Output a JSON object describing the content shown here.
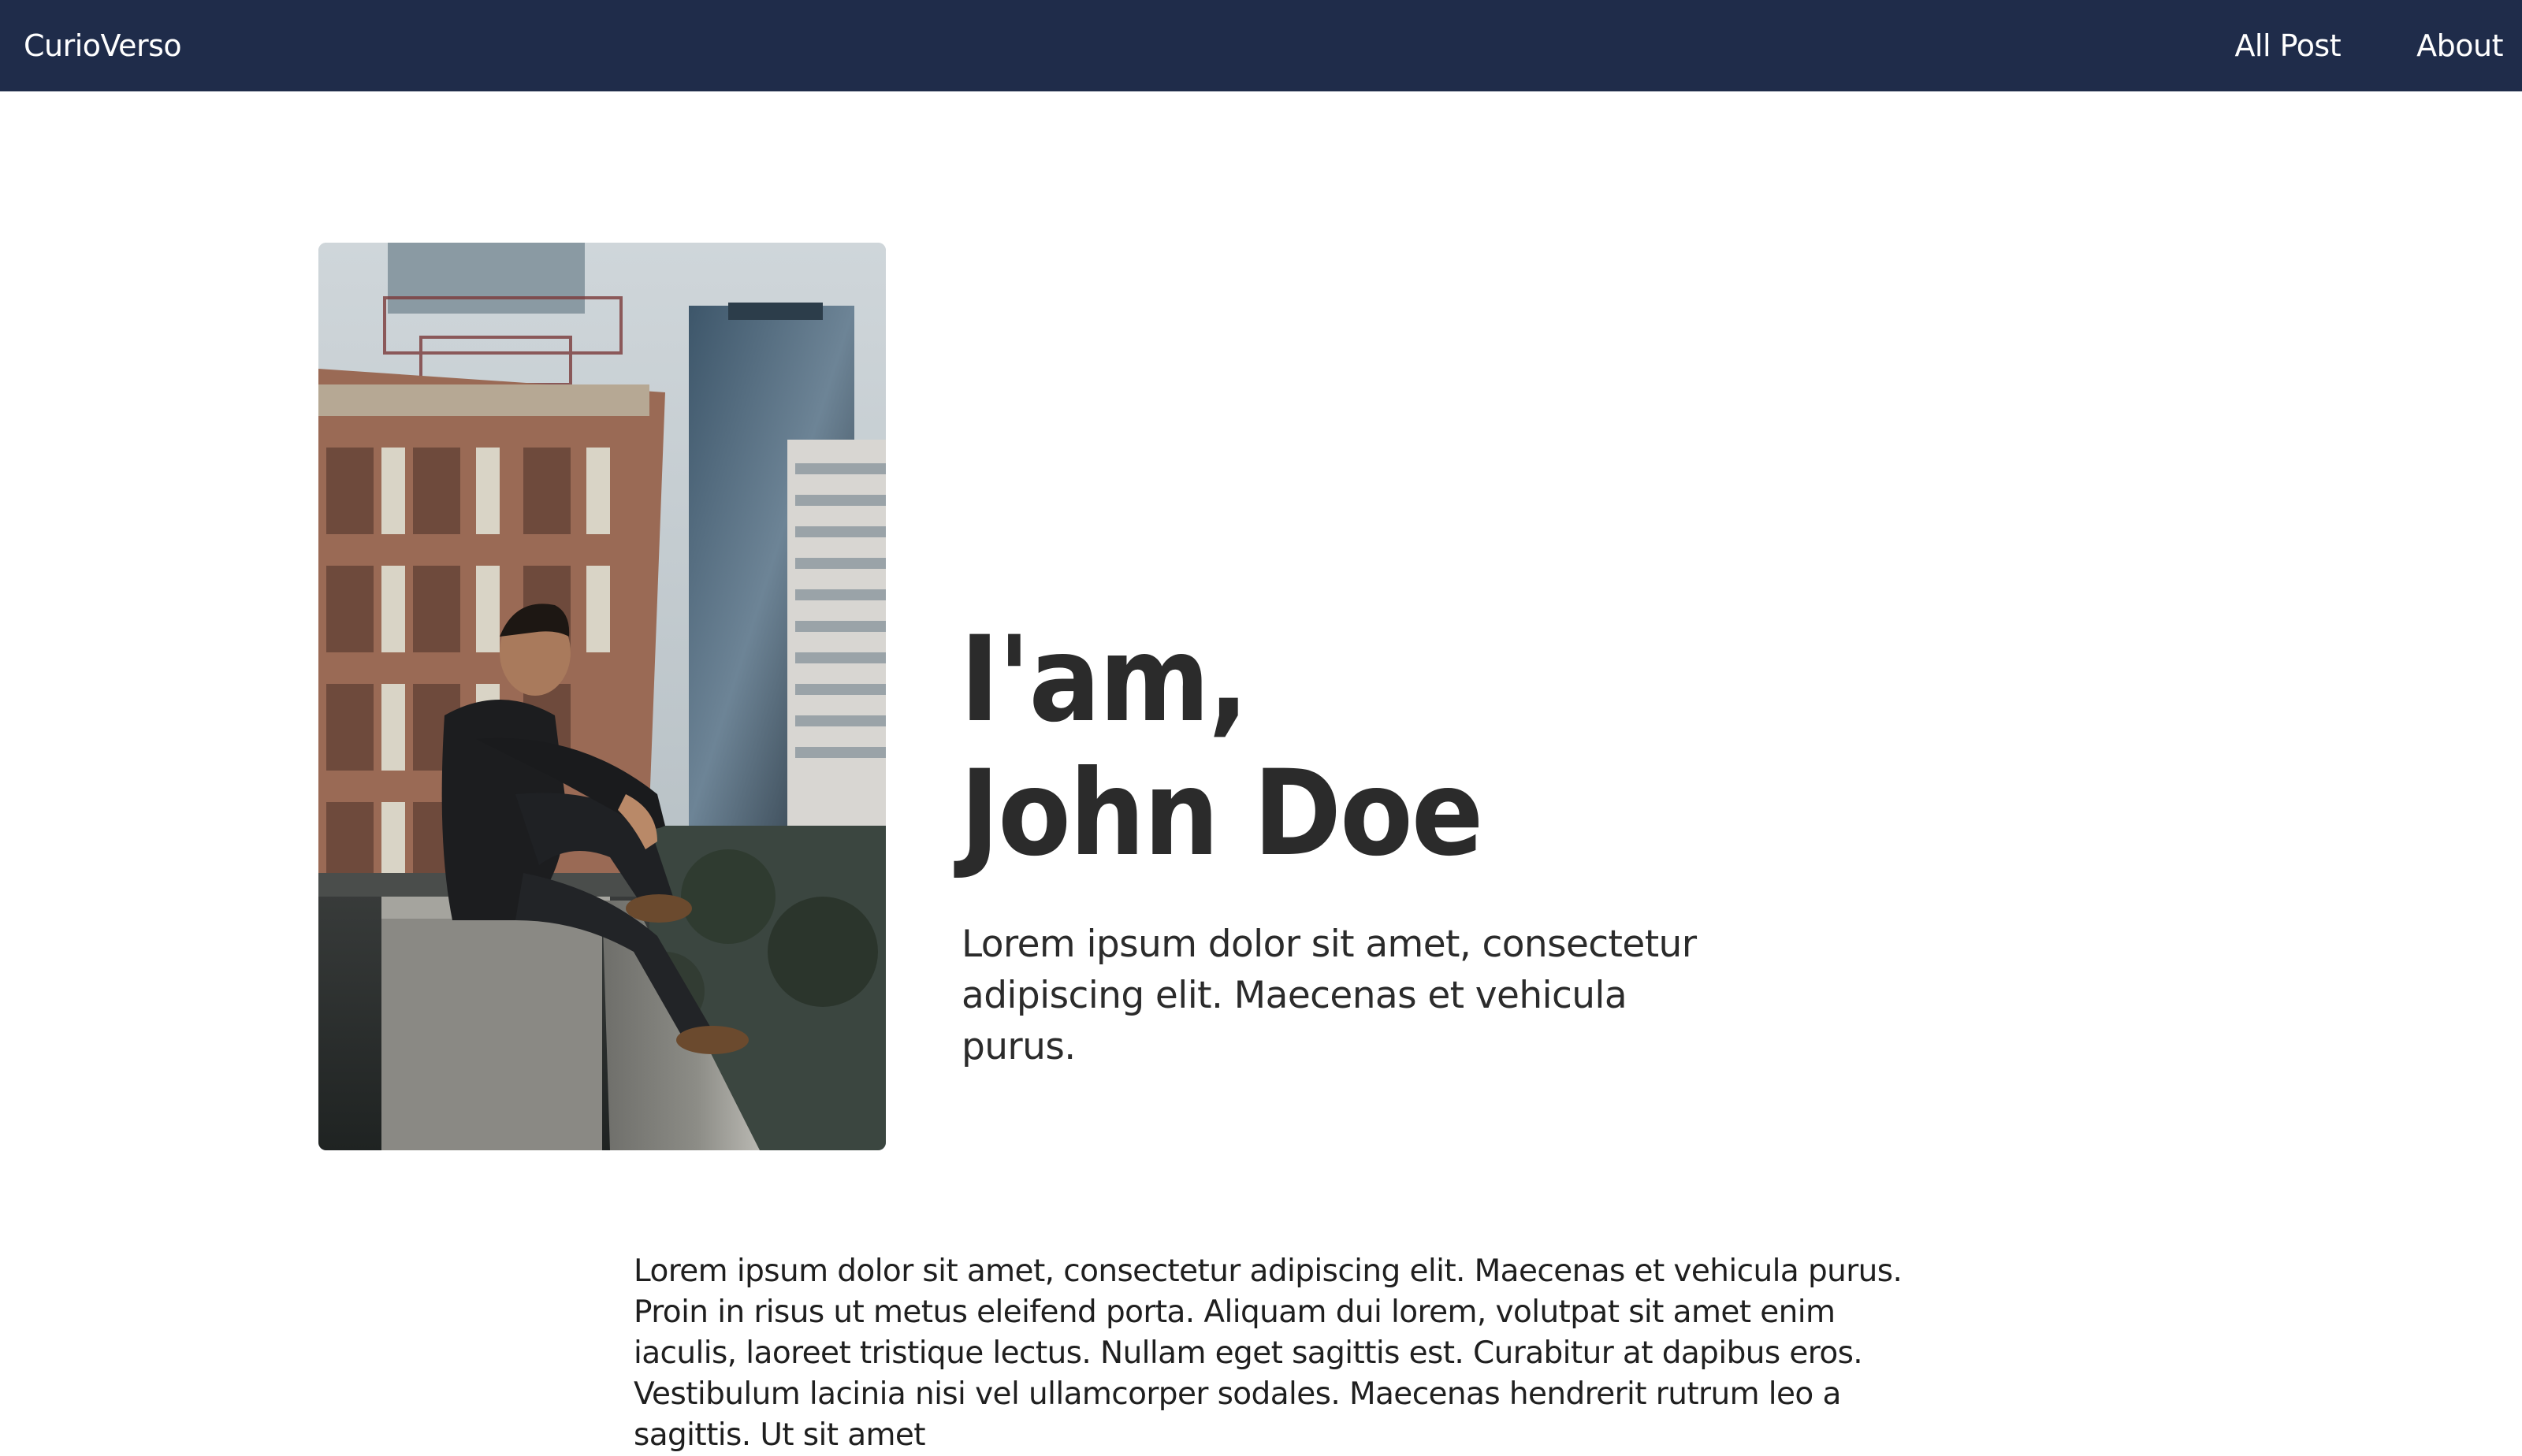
{
  "navbar": {
    "brand": "CurioVerso",
    "links": [
      {
        "label": "All Post"
      },
      {
        "label": "About"
      }
    ],
    "background_color": "#1f2c4a"
  },
  "hero": {
    "heading_line1": "I'am,",
    "heading_line2": "John Doe",
    "subtitle": "Lorem ipsum dolor sit amet, consectetur adipiscing elit. Maecenas et vehicula purus."
  },
  "body": {
    "paragraph": "Lorem ipsum dolor sit amet, consectetur adipiscing elit. Maecenas et vehicula purus. Proin in risus ut metus eleifend porta. Aliquam dui lorem, volutpat sit amet enim iaculis, laoreet tristique lectus. Nullam eget sagittis est. Curabitur at dapibus eros. Vestibulum lacinia nisi vel ullamcorper sodales. Maecenas hendrerit rutrum leo a sagittis. Ut sit amet"
  }
}
